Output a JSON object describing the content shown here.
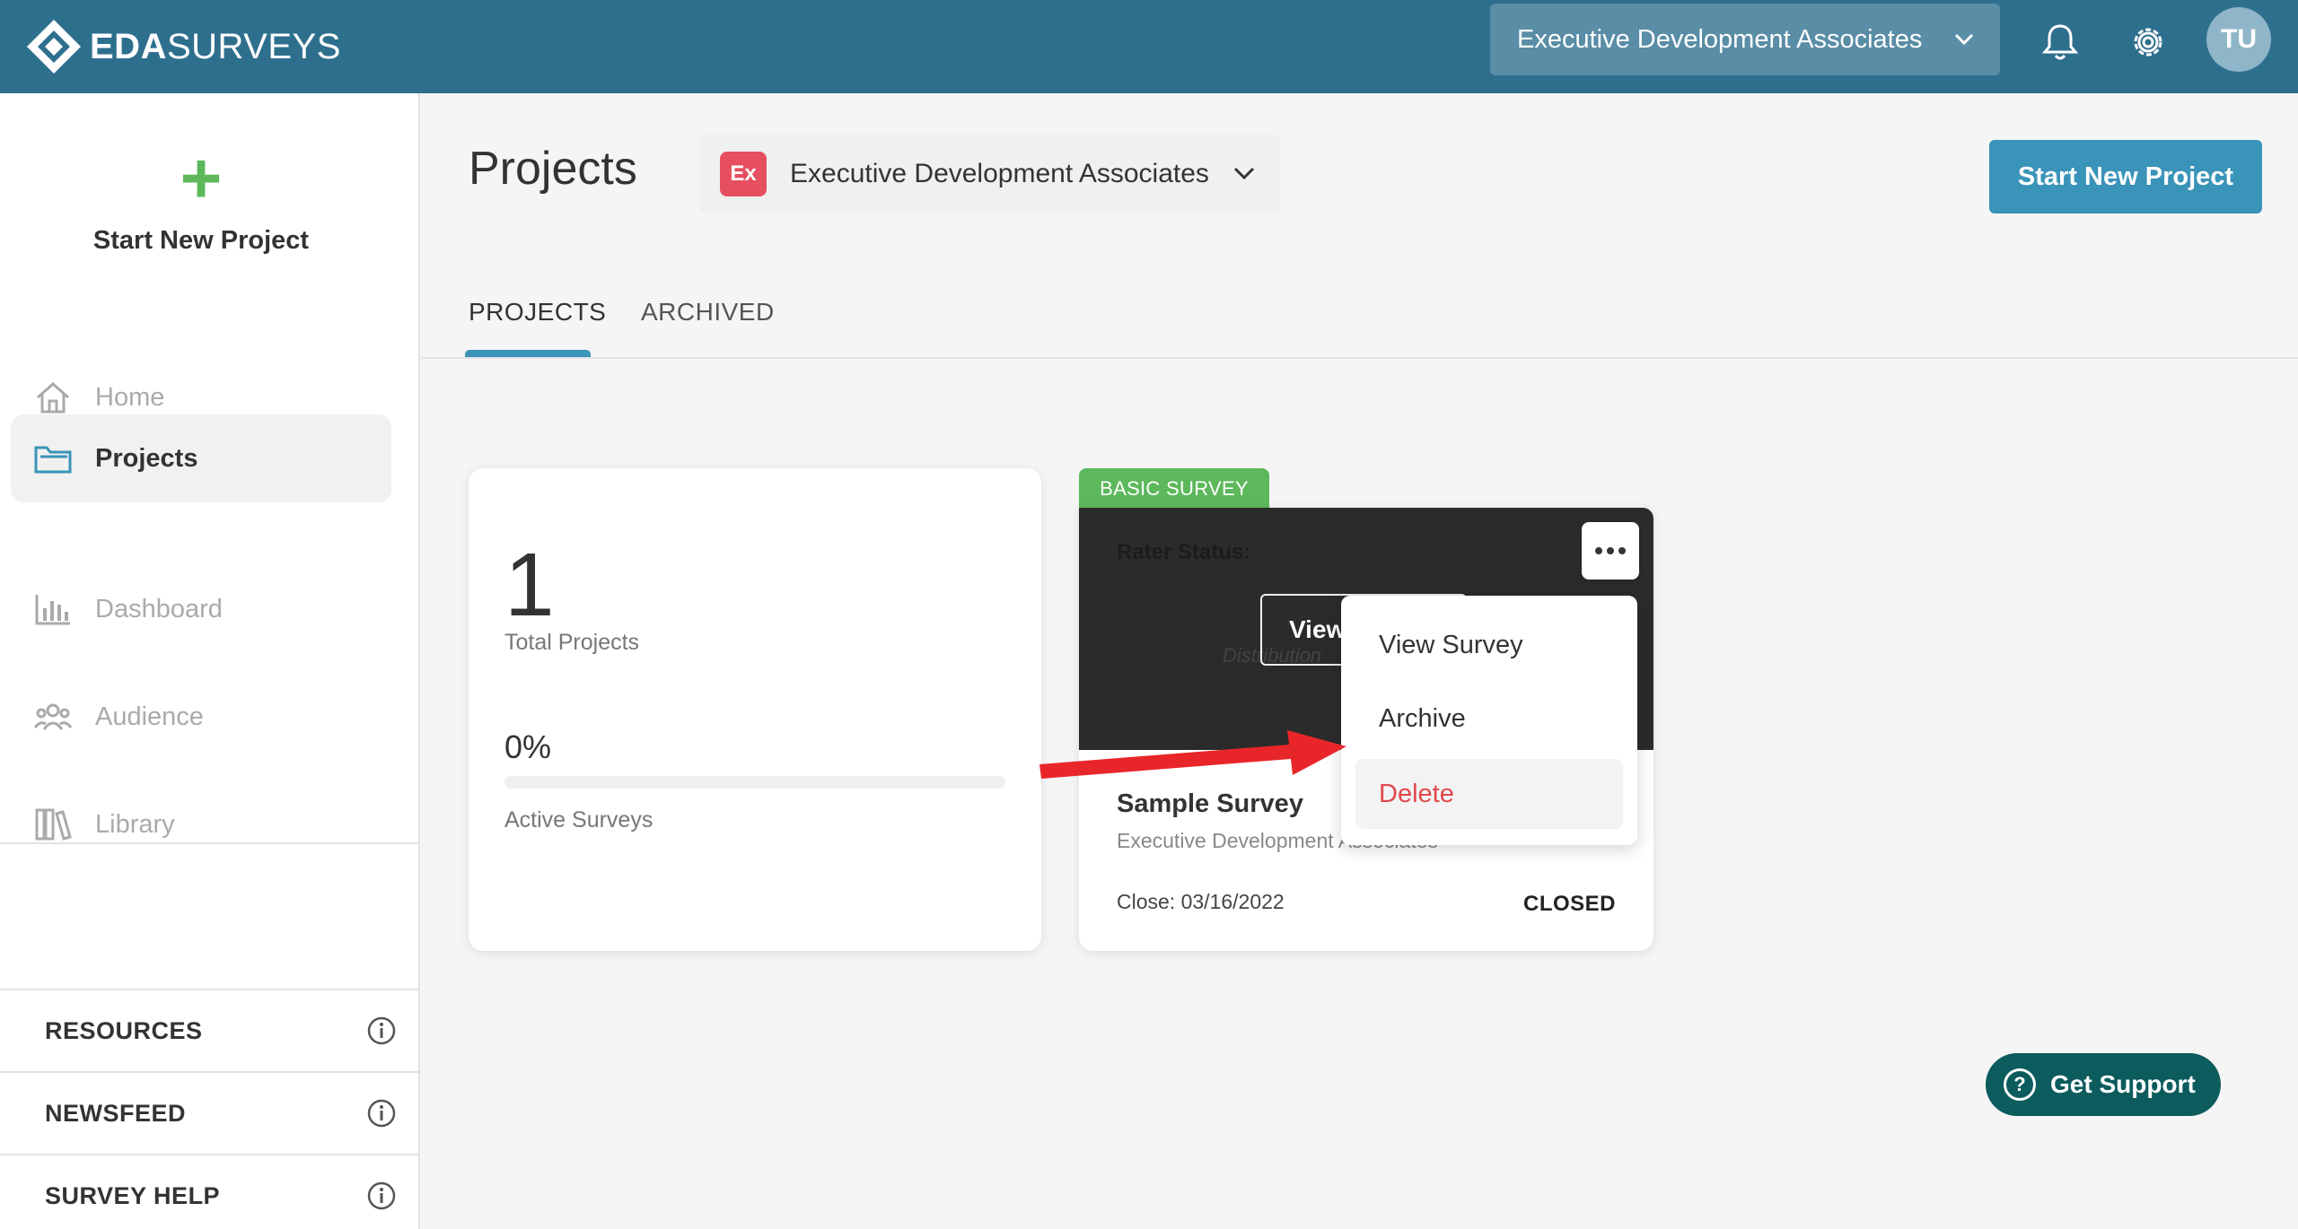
{
  "header": {
    "logo_bold": "EDA",
    "logo_rest": "SURVEYS",
    "org_selector": "Executive Development Associates",
    "avatar_initials": "TU",
    "icons": [
      "bell-icon",
      "gear-icon"
    ]
  },
  "sidebar": {
    "start_new_project": "Start New Project",
    "items": [
      {
        "label": "Home",
        "icon": "home-icon",
        "active": false
      },
      {
        "label": "Projects",
        "icon": "folder-icon",
        "active": true
      },
      {
        "label": "Dashboard",
        "icon": "bar-chart-icon",
        "active": false
      },
      {
        "label": "Audience",
        "icon": "people-icon",
        "active": false
      },
      {
        "label": "Library",
        "icon": "library-icon",
        "active": false
      }
    ],
    "sections": [
      {
        "label": "RESOURCES"
      },
      {
        "label": "NEWSFEED"
      },
      {
        "label": "SURVEY HELP"
      }
    ]
  },
  "main": {
    "title": "Projects",
    "org_badge": "Ex",
    "org_name": "Executive Development Associates",
    "start_button": "Start New Project",
    "tabs": [
      {
        "label": "PROJECTS",
        "active": true
      },
      {
        "label": "ARCHIVED",
        "active": false
      }
    ],
    "stats": {
      "total": "1",
      "total_label": "Total Projects",
      "active_pct": "0%",
      "active_fraction": 0,
      "active_label": "Active Surveys"
    },
    "survey_card": {
      "tag": "BASIC SURVEY",
      "rater_status": "Rater Status:",
      "view_button": "View",
      "dist_text": "Distribution",
      "title": "Sample Survey",
      "org": "Executive Development Associates",
      "close": "Close: 03/16/2022",
      "status": "CLOSED"
    },
    "menu": [
      {
        "label": "View Survey"
      },
      {
        "label": "Archive"
      },
      {
        "label": "Delete"
      }
    ]
  },
  "support": {
    "label": "Get Support"
  },
  "colors": {
    "header": "#2e6f8e",
    "accent": "#3a93b8",
    "plus": "#5db85c",
    "tag": "#5db85c",
    "danger": "#e0474c",
    "support": "#0c5b5d",
    "arrow": "#e8262a"
  }
}
